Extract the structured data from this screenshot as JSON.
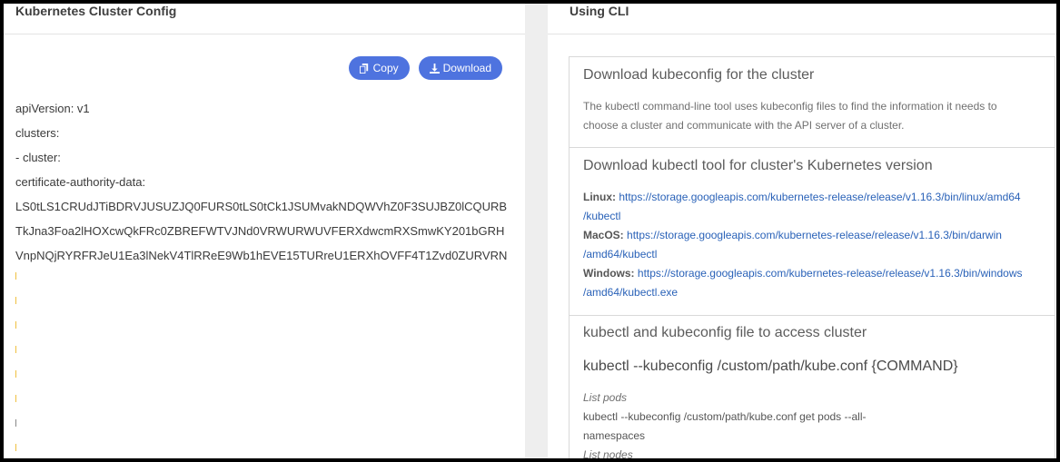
{
  "left": {
    "title": "Kubernetes Cluster Config",
    "copy_label": "Copy",
    "download_label": "Download",
    "yaml_lines": [
      "apiVersion: v1",
      "clusters:",
      "- cluster:",
      "certificate-authority-data:",
      "LS0tLS1CRUdJTiBDRVJUSUZJQ0FURS0tLS0tCk1JSUMvakNDQWVhZ0F3SUJBZ0lCQURB",
      "TkJna3Foa2lHOXcwQkFRc0ZBREFWTVJNd0VRWURWUVFERXdwcmRXSmwKY201bGRH",
      "VnpNQjRYRFRJeU1Ea3lNekV4TlRReE9Wb1hEVE15TURreU1ERXhOVFF4T1Zvd0ZURVRN"
    ]
  },
  "right": {
    "title": "Using CLI",
    "kubeconfig": {
      "title": "Download kubeconfig for the cluster",
      "line1": "The kubectl command-line tool uses kubeconfig files to find the information it needs to",
      "line2": "choose a cluster and communicate with the API server of a cluster."
    },
    "kubectl": {
      "title": "Download kubectl tool for cluster's Kubernetes version",
      "linux_label": "Linux:",
      "linux_url_1": "https://storage.googleapis.com/kubernetes-release/release/v1.16.3/bin/linux/amd64",
      "linux_url_2": "/kubectl",
      "macos_label": "MacOS:",
      "macos_url_1": "https://storage.googleapis.com/kubernetes-release/release/v1.16.3/bin/darwin",
      "macos_url_2": "/amd64/kubectl",
      "windows_label": "Windows:",
      "windows_url_1": "https://storage.googleapis.com/kubernetes-release/release/v1.16.3/bin/windows",
      "windows_url_2": "/amd64/kubectl.exe"
    },
    "access": {
      "title": "kubectl and kubeconfig file to access cluster",
      "command": "kubectl --kubeconfig /custom/path/kube.conf {COMMAND}",
      "list_pods_label": "List pods",
      "list_pods_cmd_1": "kubectl --kubeconfig /custom/path/kube.conf get pods --all-",
      "list_pods_cmd_2": "namespaces",
      "list_nodes_label": "List nodes"
    }
  },
  "colors": {
    "button": "#4e73df",
    "link": "#2a62b8"
  }
}
